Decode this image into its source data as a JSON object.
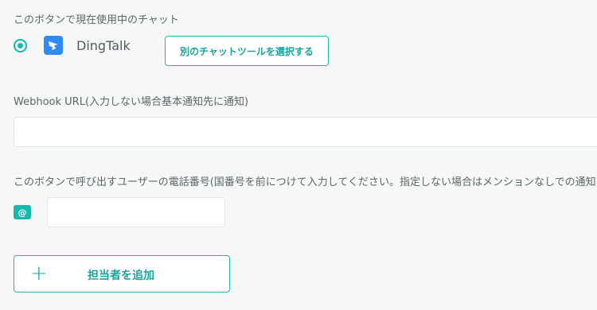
{
  "chat_tool": {
    "section_label": "このボタンで現在使用中のチャット",
    "current_tool_name": "DingTalk",
    "logo_icon": "dingtalk-logo-icon",
    "select_button_label": "別のチャットツールを選択する"
  },
  "webhook": {
    "label": "Webhook URL(入力しない場合基本通知先に通知)",
    "value": "",
    "placeholder": ""
  },
  "phone": {
    "label": "このボタンで呼び出すユーザーの電話番号(国番号を前につけて入力してください。指定しない場合はメンションなしでの通知)",
    "badge": "@",
    "value": "",
    "placeholder": ""
  },
  "add_assignee": {
    "icon": "+",
    "label": "担当者を追加"
  },
  "colors": {
    "accent": "#17b8b0",
    "background": "#f6f7f7",
    "dingtalk_blue": "#2f8af5"
  }
}
